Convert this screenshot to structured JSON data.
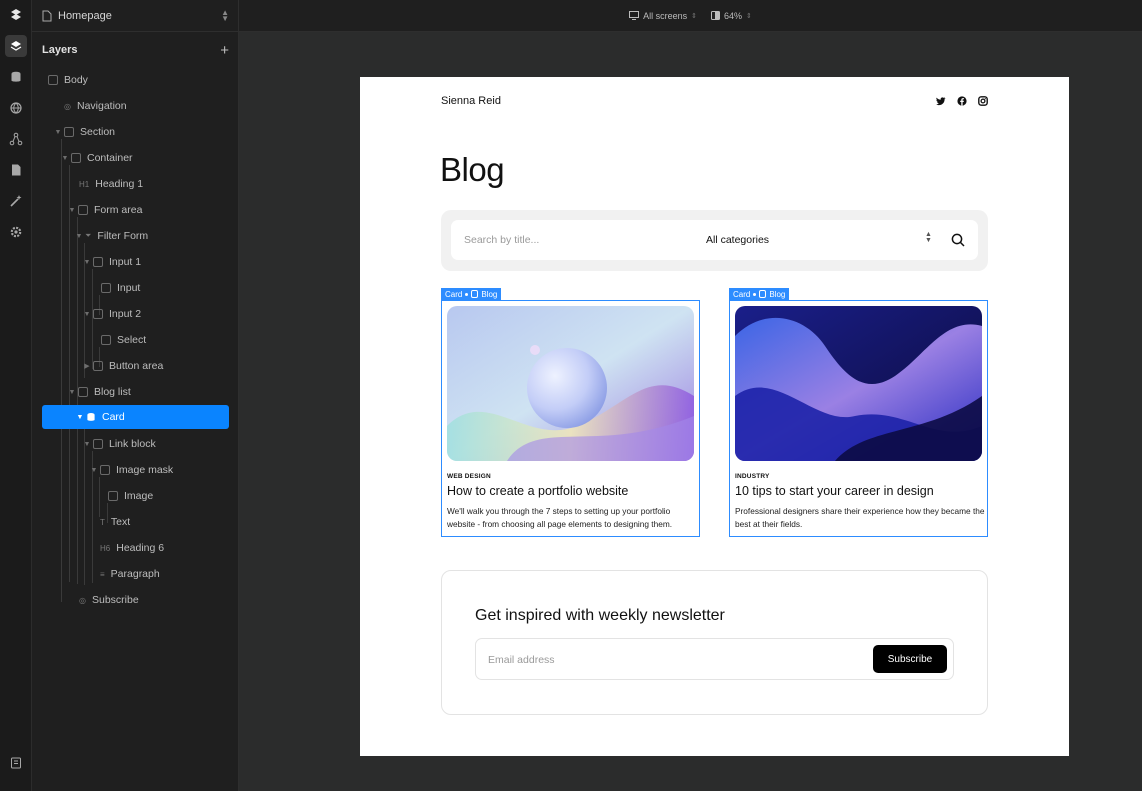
{
  "panel": {
    "page_name": "Homepage",
    "layers_title": "Layers",
    "add_label": "+"
  },
  "layers": [
    {
      "label": "Body"
    },
    {
      "label": "Navigation"
    },
    {
      "label": "Section"
    },
    {
      "label": "Container"
    },
    {
      "label": "Heading 1",
      "prefix": "H1"
    },
    {
      "label": "Form area"
    },
    {
      "label": "Filter Form"
    },
    {
      "label": "Input 1"
    },
    {
      "label": "Input"
    },
    {
      "label": "Input 2"
    },
    {
      "label": "Select"
    },
    {
      "label": "Button area"
    },
    {
      "label": "Blog list"
    },
    {
      "label": "Card",
      "selected": true
    },
    {
      "label": "Link block"
    },
    {
      "label": "Image mask"
    },
    {
      "label": "Image"
    },
    {
      "label": "Text"
    },
    {
      "label": "Heading 6",
      "prefix": "H6"
    },
    {
      "label": "Paragraph"
    },
    {
      "label": "Subscribe"
    }
  ],
  "topbar": {
    "screens_label": "All screens",
    "zoom_label": "64%"
  },
  "site": {
    "name": "Sienna Reid",
    "socials": [
      "twitter-icon",
      "facebook-icon",
      "instagram-icon"
    ],
    "title": "Blog",
    "search_placeholder": "Search by title...",
    "category_value": "All categories",
    "cards": [
      {
        "tag": "Card",
        "tag_collection": "Blog",
        "category": "WEB DESIGN",
        "title": "How to create a portfolio website",
        "description": "We'll walk you through the 7 steps to setting up your portfolio website - from choosing all page elements to designing them."
      },
      {
        "tag": "Card",
        "tag_collection": "Blog",
        "category": "INDUSTRY",
        "title": "10 tips to start your career in design",
        "description": "Professional designers share their experience how they became the best at their fields."
      }
    ],
    "newsletter": {
      "title": "Get inspired with weekly newsletter",
      "email_placeholder": "Email address",
      "button_label": "Subscribe"
    }
  },
  "colors": {
    "selection": "#0a84ff",
    "card_outline": "#2d8cff",
    "canvas_bg": "#2b2c2c",
    "panel_bg": "#1f1f1f"
  }
}
